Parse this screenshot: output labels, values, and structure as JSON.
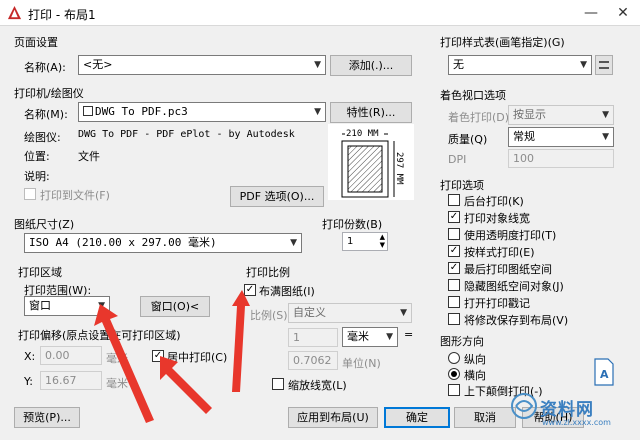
{
  "window": {
    "title": "打印 - 布局1",
    "minimize": "—",
    "close": "✕"
  },
  "page_setup": {
    "group": "页面设置",
    "name_label": "名称(A):",
    "name_value": "<无>",
    "add_button": "添加(.)..."
  },
  "printer": {
    "group": "打印机/绘图仪",
    "name_label": "名称(M):",
    "name_value": "DWG To PDF.pc3",
    "properties_button": "特性(R)...",
    "plotter_label": "绘图仪:",
    "plotter_value": "DWG To PDF - PDF ePlot - by Autodesk",
    "location_label": "位置:",
    "location_value": "文件",
    "description_label": "说明:",
    "print_to_file": "打印到文件(F)",
    "pdf_options_button": "PDF 选项(O)...",
    "preview_width": "210 MM",
    "preview_height": "297 MM"
  },
  "paper_size": {
    "group": "图纸尺寸(Z)",
    "value": "ISO A4 (210.00 x 297.00 毫米)"
  },
  "copies": {
    "group": "打印份数(B)",
    "value": "1"
  },
  "plot_area": {
    "group": "打印区域",
    "range_label": "打印范围(W):",
    "range_value": "窗口",
    "window_button": "窗口(O)<"
  },
  "plot_offset": {
    "group": "打印偏移(原点设置在可打印区域)",
    "x_label": "X:",
    "x_value": "0.00",
    "x_unit": "毫米",
    "y_label": "Y:",
    "y_value": "16.67",
    "y_unit": "毫米",
    "center_label": "居中打印(C)"
  },
  "plot_scale": {
    "group": "打印比例",
    "fit_label": "布满图纸(I)",
    "scale_label": "比例(S):",
    "scale_value": "自定义",
    "num_value": "1",
    "num_unit": "毫米",
    "denom_value": "0.7062",
    "denom_unit": "单位(N)",
    "lineweights_label": "缩放线宽(L)"
  },
  "style_table": {
    "group": "打印样式表(画笔指定)(G)",
    "value": "无"
  },
  "shaded_viewport": {
    "group": "着色视口选项",
    "shade_label": "着色打印(D)",
    "shade_value": "按显示",
    "quality_label": "质量(Q)",
    "quality_value": "常规",
    "dpi_label": "DPI",
    "dpi_value": "100"
  },
  "plot_options": {
    "group": "打印选项",
    "items": [
      {
        "label": "后台打印(K)",
        "checked": false
      },
      {
        "label": "打印对象线宽",
        "checked": true
      },
      {
        "label": "使用透明度打印(T)",
        "checked": false
      },
      {
        "label": "按样式打印(E)",
        "checked": true
      },
      {
        "label": "最后打印图纸空间",
        "checked": true
      },
      {
        "label": "隐藏图纸空间对象(J)",
        "checked": false
      },
      {
        "label": "打开打印戳记",
        "checked": false
      },
      {
        "label": "将修改保存到布局(V)",
        "checked": false
      }
    ]
  },
  "orientation": {
    "group": "图形方向",
    "portrait": "纵向",
    "landscape": "横向",
    "upside_down": "上下颠倒打印(-)"
  },
  "footer": {
    "preview": "预览(P)...",
    "apply": "应用到布局(U)",
    "ok": "确定",
    "cancel": "取消",
    "help": "帮助(H)"
  },
  "watermark": {
    "text": "资料网",
    "url": "www.zl.xxxx.com"
  },
  "colors": {
    "arrow": "#e8372c",
    "accent": "#0078d7"
  }
}
